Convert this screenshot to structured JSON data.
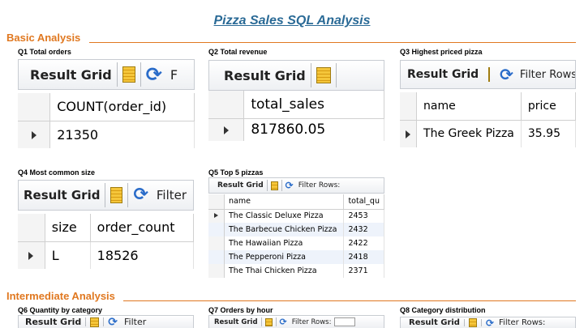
{
  "title": "Pizza Sales SQL Analysis",
  "sections": {
    "basic": "Basic Analysis",
    "intermediate": "Intermediate Analysis"
  },
  "toolbar": {
    "result_grid": "Result Grid",
    "filter_rows": "Filter Rows:",
    "filter_short": "Filter",
    "filter_cut": "F"
  },
  "queries": {
    "q1": {
      "label": "Q1 Total orders",
      "columns": [
        "COUNT(order_id)"
      ],
      "rows": [
        [
          "21350"
        ]
      ]
    },
    "q2": {
      "label": "Q2 Total revenue",
      "columns": [
        "total_sales"
      ],
      "rows": [
        [
          "817860.05"
        ]
      ]
    },
    "q3": {
      "label": "Q3 Highest priced pizza",
      "columns": [
        "name",
        "price"
      ],
      "rows": [
        [
          "The Greek Pizza",
          "35.95"
        ]
      ]
    },
    "q4": {
      "label": "Q4 Most common size",
      "columns": [
        "size",
        "order_count"
      ],
      "rows": [
        [
          "L",
          "18526"
        ]
      ]
    },
    "q5": {
      "label": "Q5 Top 5 pizzas",
      "columns": [
        "name",
        "total_qu"
      ],
      "rows": [
        [
          "The Classic Deluxe Pizza",
          "2453"
        ],
        [
          "The Barbecue Chicken Pizza",
          "2432"
        ],
        [
          "The Hawaiian Pizza",
          "2422"
        ],
        [
          "The Pepperoni Pizza",
          "2418"
        ],
        [
          "The Thai Chicken Pizza",
          "2371"
        ]
      ]
    },
    "q6": {
      "label": "Q6 Quantity by category"
    },
    "q7": {
      "label": "Q7 Orders by hour"
    },
    "q8": {
      "label": "Q8 Category distribution"
    }
  },
  "colors": {
    "title": "#2a6a96",
    "section": "#e07820"
  },
  "icons": [
    "grid-view-icon",
    "refresh-icon",
    "row-pointer-icon"
  ]
}
